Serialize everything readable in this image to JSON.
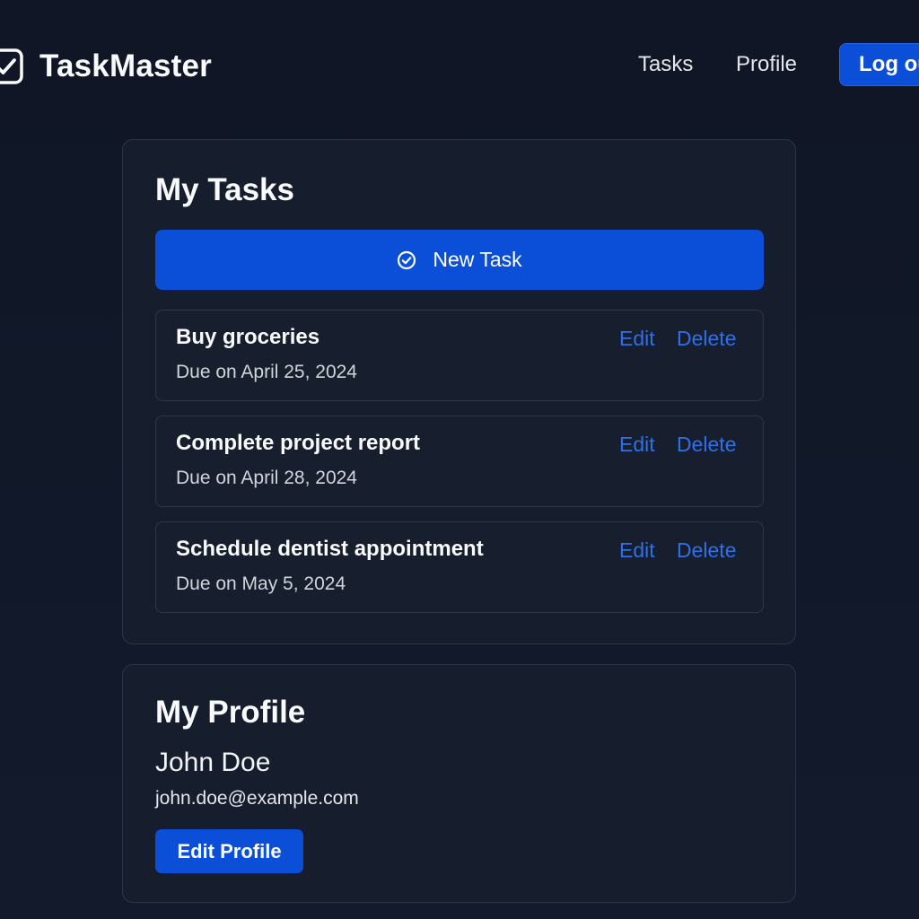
{
  "header": {
    "brand_name": "TaskMaster",
    "brand_icon": "checkbox-icon",
    "nav": [
      {
        "label": "Tasks"
      },
      {
        "label": "Profile"
      }
    ],
    "logout_label": "Log out"
  },
  "tasks_card": {
    "title": "My Tasks",
    "new_task_label": "New Task",
    "new_task_icon": "check-circle-icon",
    "tasks": [
      {
        "title": "Buy groceries",
        "due": "Due on April 25, 2024",
        "edit_label": "Edit",
        "delete_label": "Delete"
      },
      {
        "title": "Complete project report",
        "due": "Due on April 28, 2024",
        "edit_label": "Edit",
        "delete_label": "Delete"
      },
      {
        "title": "Schedule dentist appointment",
        "due": "Due on May 5, 2024",
        "edit_label": "Edit",
        "delete_label": "Delete"
      }
    ]
  },
  "profile_card": {
    "title": "My Profile",
    "name": "John Doe",
    "email": "john.doe@example.com",
    "edit_profile_label": "Edit Profile"
  },
  "colors": {
    "background": "#111827",
    "card": "#161d2d",
    "accent": "#0b4fd8",
    "link": "#2f6fe8"
  }
}
